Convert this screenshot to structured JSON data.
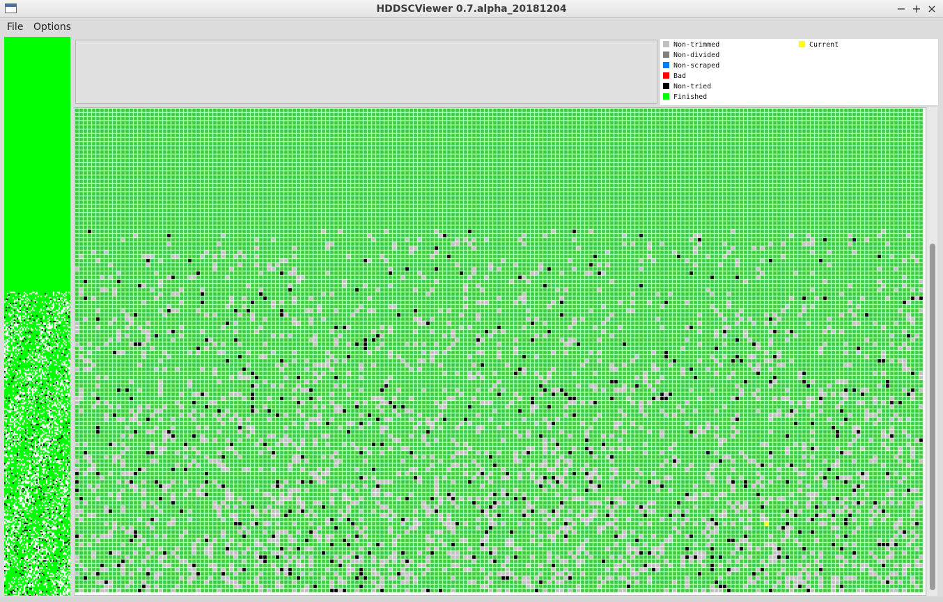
{
  "window": {
    "title": "HDDSCViewer 0.7.alpha_20181204",
    "controls": {
      "minimize": "−",
      "maximize": "+",
      "close": "×"
    }
  },
  "menu": {
    "file": "File",
    "options": "Options"
  },
  "legend": {
    "items": [
      {
        "label": "Non-trimmed",
        "color": "#c0c0c0"
      },
      {
        "label": "Non-divided",
        "color": "#808080"
      },
      {
        "label": "Non-scraped",
        "color": "#0080ff"
      },
      {
        "label": "Bad",
        "color": "#ff0000"
      },
      {
        "label": "Non-tried",
        "color": "#000000"
      },
      {
        "label": "Finished",
        "color": "#00ff00"
      }
    ],
    "current": {
      "label": "Current",
      "color": "#ffff00"
    }
  },
  "grid": {
    "cell_color_finished": "#3ccd3c",
    "grid_line_color": "#ffffff"
  }
}
